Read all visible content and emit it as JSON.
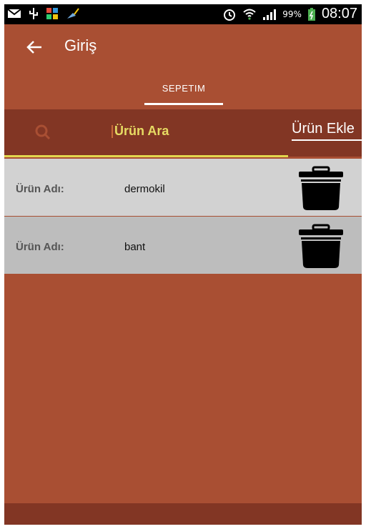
{
  "status_bar": {
    "battery_percent": "99%",
    "time": "08:07"
  },
  "app_bar": {
    "title": "Giriş"
  },
  "tabs": [
    {
      "label": "SEPETIM",
      "selected": true
    }
  ],
  "search": {
    "value": "Ürün Ara"
  },
  "add_button": {
    "label": "Ürün Ekle"
  },
  "items": [
    {
      "label": "Ürün Adı:",
      "value": "dermokil"
    },
    {
      "label": "Ürün Adı:",
      "value": "bant"
    }
  ],
  "colors": {
    "primary": "#a94f33",
    "dark": "#823624",
    "accent": "#e2d84e"
  }
}
